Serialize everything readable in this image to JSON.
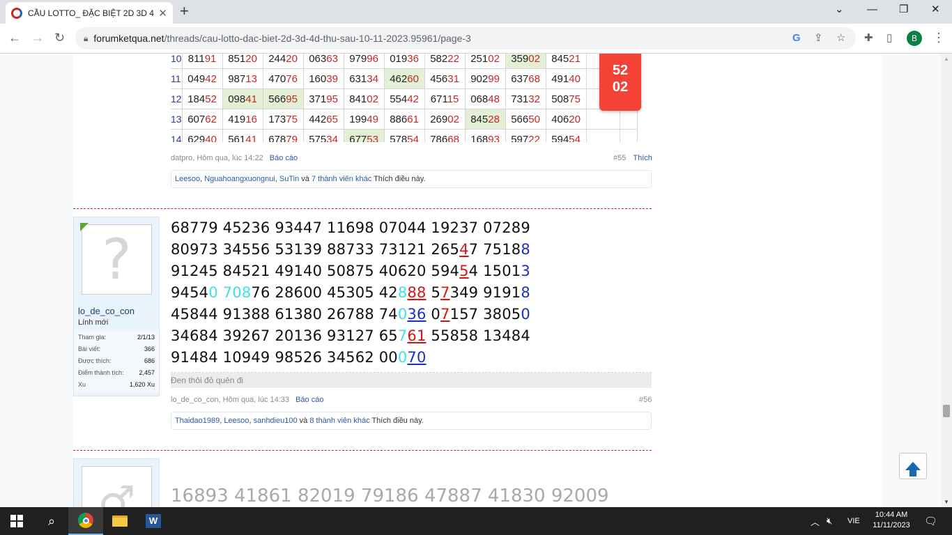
{
  "browser": {
    "tab_title": "CẦU LOTTO_ ĐẶC BIỆT 2D 3D 4D",
    "url_host": "forumketqua.net",
    "url_path": "/threads/cau-lotto-dac-biet-2d-3d-4d-thu-sau-10-11-2023.95961/page-3",
    "profile_initial": "B",
    "new_tab": "+",
    "close": "✕"
  },
  "lotto_table": {
    "rows": [
      {
        "idx": "10",
        "cells": [
          [
            "811",
            "91"
          ],
          [
            "851",
            "20"
          ],
          [
            "244",
            "20"
          ],
          [
            "063",
            "63"
          ],
          [
            "979",
            "96"
          ],
          [
            "019",
            "36"
          ],
          [
            "582",
            "22"
          ],
          [
            "251",
            "02"
          ],
          [
            "359",
            "02"
          ],
          [
            "845",
            "21"
          ]
        ],
        "hl": [
          8
        ]
      },
      {
        "idx": "11",
        "cells": [
          [
            "049",
            "42"
          ],
          [
            "987",
            "13"
          ],
          [
            "470",
            "76"
          ],
          [
            "160",
            "39"
          ],
          [
            "631",
            "34"
          ],
          [
            "462",
            "60"
          ],
          [
            "456",
            "31"
          ],
          [
            "902",
            "99"
          ],
          [
            "637",
            "68"
          ],
          [
            "491",
            "40"
          ]
        ],
        "hl": [
          5
        ]
      },
      {
        "idx": "12",
        "cells": [
          [
            "184",
            "52"
          ],
          [
            "098",
            "41"
          ],
          [
            "566",
            "95"
          ],
          [
            "371",
            "95"
          ],
          [
            "841",
            "02"
          ],
          [
            "554",
            "42"
          ],
          [
            "671",
            "15"
          ],
          [
            "068",
            "48"
          ],
          [
            "731",
            "32"
          ],
          [
            "508",
            "75"
          ]
        ],
        "hl": [
          1,
          2
        ]
      },
      {
        "idx": "13",
        "cells": [
          [
            "607",
            "62"
          ],
          [
            "419",
            "16"
          ],
          [
            "173",
            "75"
          ],
          [
            "442",
            "65"
          ],
          [
            "199",
            "49"
          ],
          [
            "886",
            "61"
          ],
          [
            "269",
            "02"
          ],
          [
            "845",
            "28"
          ],
          [
            "566",
            "50"
          ],
          [
            "406",
            "20"
          ]
        ],
        "hl": [
          7
        ]
      },
      {
        "idx": "14",
        "cells": [
          [
            "629",
            "40"
          ],
          [
            "561",
            "41"
          ],
          [
            "678",
            "79"
          ],
          [
            "575",
            "34"
          ],
          [
            "677",
            "53"
          ],
          [
            "578",
            "54"
          ],
          [
            "786",
            "68"
          ],
          [
            "168",
            "93"
          ],
          [
            "597",
            "22"
          ],
          [
            "594",
            "54"
          ]
        ],
        "hl": [
          4
        ]
      }
    ],
    "badge_line1": "52",
    "badge_line2": "02"
  },
  "post55": {
    "author": "datpro",
    "time": "Hôm qua, lúc 14:22",
    "report": "Báo cáo",
    "number": "#55",
    "like": "Thích",
    "likes": {
      "users": [
        "Leesoo",
        "Nguahoangxuongnui",
        "SuTin"
      ],
      "conj": "và",
      "others": "7 thành viên khác",
      "suffix": "Thích điều này."
    }
  },
  "post56": {
    "username": "lo_de_co_con",
    "usertitle": "Lính mới",
    "stats": [
      {
        "label": "Tham gia:",
        "value": "2/1/13"
      },
      {
        "label": "Bài viết:",
        "value": "366"
      },
      {
        "label": "Được thích:",
        "value": "686"
      },
      {
        "label": "Điểm thành tích:",
        "value": "2,457"
      },
      {
        "label": "Xu",
        "value": "1,620 Xu"
      }
    ],
    "lines": [
      "68779 45236 93447 11698 07044 19237 07289",
      "80973 34556 53139 88733 73121 26547 75188",
      "91245 84521 49140 50875 40620 59454 15013",
      "94540 70876 28600 45305 42888 57349 91918",
      "45844 91388 61380 26788 74036 07157 38050",
      "34684 39267 20136 93127 65761 55858 13484",
      "91484 10949 98526 34562 00070"
    ],
    "signature": "Đen thôi đỏ quên đi",
    "author": "lo_de_co_con",
    "time": "Hôm qua, lúc 14:33",
    "report": "Báo cáo",
    "number": "#56",
    "likes": {
      "users": [
        "Thaidao1989",
        "Leesoo",
        "sanhdieu100"
      ],
      "conj": "và",
      "others": "8 thành viên khác",
      "suffix": "Thích điều này."
    }
  },
  "post57": {
    "line": "16893 41861 82019 79186 47887 41830 92009"
  },
  "taskbar": {
    "lang": "VIE",
    "time": "10:44 AM",
    "date": "11/11/2023",
    "word_letter": "W"
  },
  "colors": {
    "accent_red": "#c62828",
    "badge_red": "#f44336",
    "link_blue": "#2b5aa0",
    "highlight_green": "#e3f0d5"
  },
  "icons": [
    "reload-icon",
    "back-icon",
    "forward-icon",
    "lock-icon",
    "google-icon",
    "share-icon",
    "star-icon",
    "extensions-icon",
    "sidepanel-icon",
    "menu-icon",
    "windows-logo-icon",
    "search-icon",
    "chrome-icon",
    "file-explorer-icon",
    "word-icon",
    "back-to-top-icon"
  ]
}
